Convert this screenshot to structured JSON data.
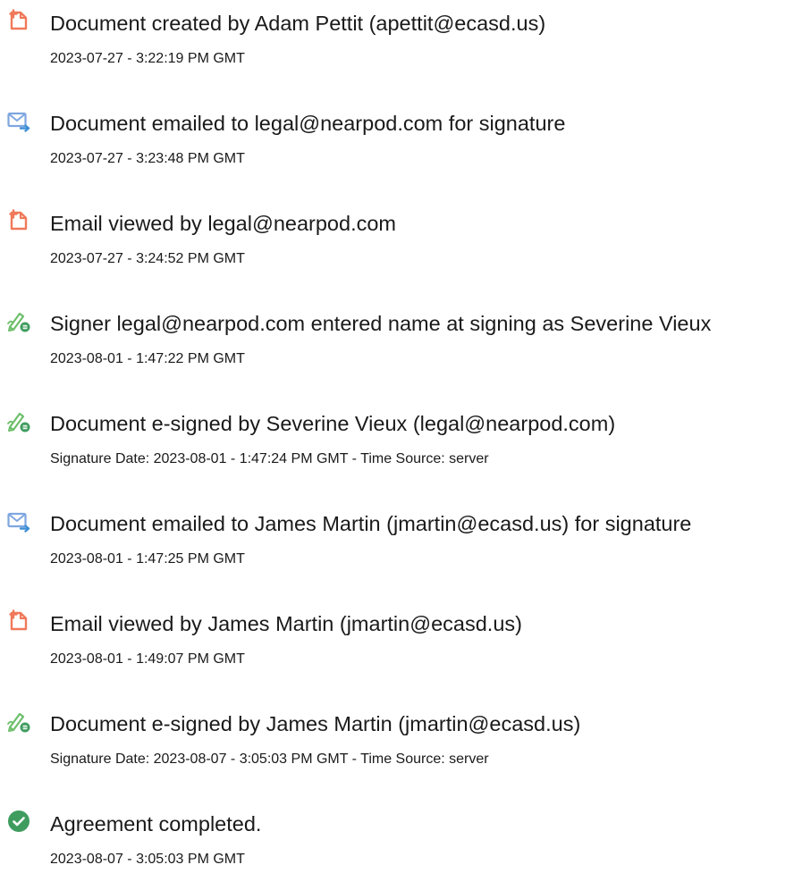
{
  "events": [
    {
      "icon": "document-created-icon",
      "description": "Document created by Adam Pettit (apettit@ecasd.us)",
      "timestamp": "2023-07-27 - 3:22:19 PM GMT"
    },
    {
      "icon": "document-emailed-icon",
      "description": "Document emailed to legal@nearpod.com for signature",
      "timestamp": "2023-07-27 - 3:23:48 PM GMT"
    },
    {
      "icon": "document-viewed-icon",
      "description": "Email viewed by legal@nearpod.com",
      "timestamp": "2023-07-27 - 3:24:52 PM GMT"
    },
    {
      "icon": "e-sign-icon",
      "description": "Signer legal@nearpod.com entered name at signing as Severine Vieux",
      "timestamp": "2023-08-01 - 1:47:22 PM GMT"
    },
    {
      "icon": "e-sign-icon",
      "description": "Document e-signed by Severine Vieux (legal@nearpod.com)",
      "timestamp": "Signature Date: 2023-08-01 - 1:47:24 PM GMT - Time Source: server"
    },
    {
      "icon": "document-emailed-icon",
      "description": "Document emailed to James Martin (jmartin@ecasd.us) for signature",
      "timestamp": "2023-08-01 - 1:47:25 PM GMT"
    },
    {
      "icon": "document-viewed-icon",
      "description": "Email viewed by James Martin (jmartin@ecasd.us)",
      "timestamp": "2023-08-01 - 1:49:07 PM GMT"
    },
    {
      "icon": "e-sign-icon",
      "description": "Document e-signed by James Martin (jmartin@ecasd.us)",
      "timestamp": "Signature Date: 2023-08-07 - 3:05:03 PM GMT - Time Source: server"
    },
    {
      "icon": "completed-check-icon",
      "description": "Agreement completed.",
      "timestamp": "2023-08-07 - 3:05:03 PM GMT"
    }
  ],
  "colors": {
    "document_icon": "#f0795a",
    "email_icon": "#7fa6e0",
    "email_arrow": "#3f8fd6",
    "pen_icon": "#6cbf6a",
    "sign_badge": "#3f9c5f",
    "check_badge": "#3f9c5f",
    "text": "#1a1a1a"
  }
}
